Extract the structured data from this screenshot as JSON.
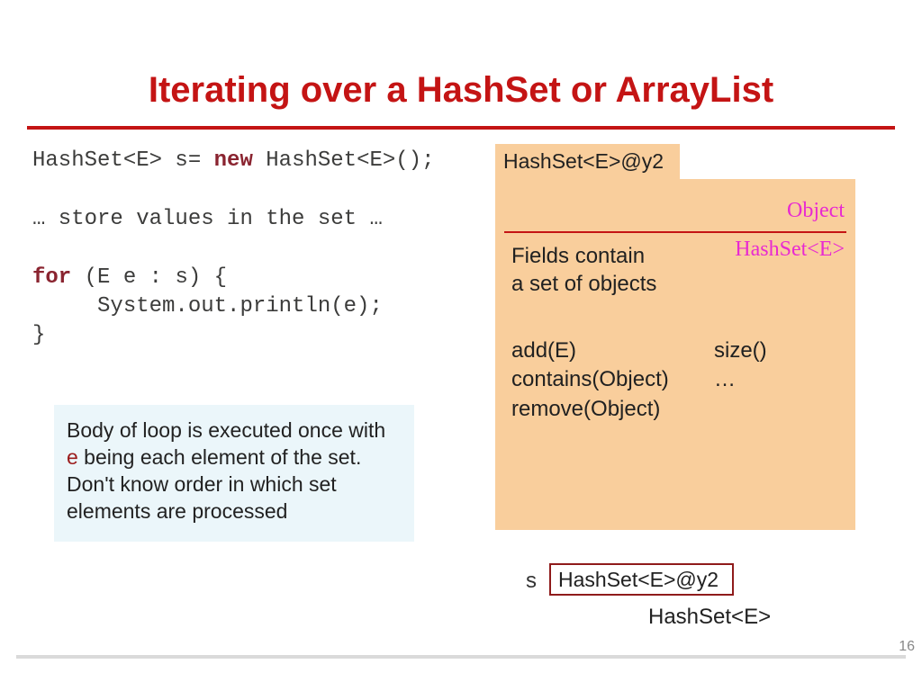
{
  "title": "Iterating over a HashSet or ArrayList",
  "code": {
    "l1_a": "HashSet<E> s= ",
    "l1_kw": "new",
    "l1_b": " HashSet<E>();",
    "l2": "… store values in the set …",
    "l3_kw": "for",
    "l3_b": " (E e : s) {",
    "l4": "     System.out.println(e);",
    "l5": "}"
  },
  "note": {
    "p1a": "Body of loop is executed once with ",
    "e": "e",
    "p1b": " being each element of the set. Don't know order in which set elements are processed"
  },
  "object": {
    "tab": "HashSet<E>@y2",
    "superclass": "Object",
    "class": "HashSet<E>",
    "fields_l1": "Fields contain",
    "fields_l2": "a set of objects",
    "methods_c1_l1": "add(E)",
    "methods_c1_l2": "contains(Object)",
    "methods_c1_l3": "remove(Object)",
    "methods_c2_l1": "size()",
    "methods_c2_l2": "…"
  },
  "var": {
    "name": "s",
    "value": "HashSet<E>@y2",
    "type": "HashSet<E>"
  },
  "page_number": "16"
}
